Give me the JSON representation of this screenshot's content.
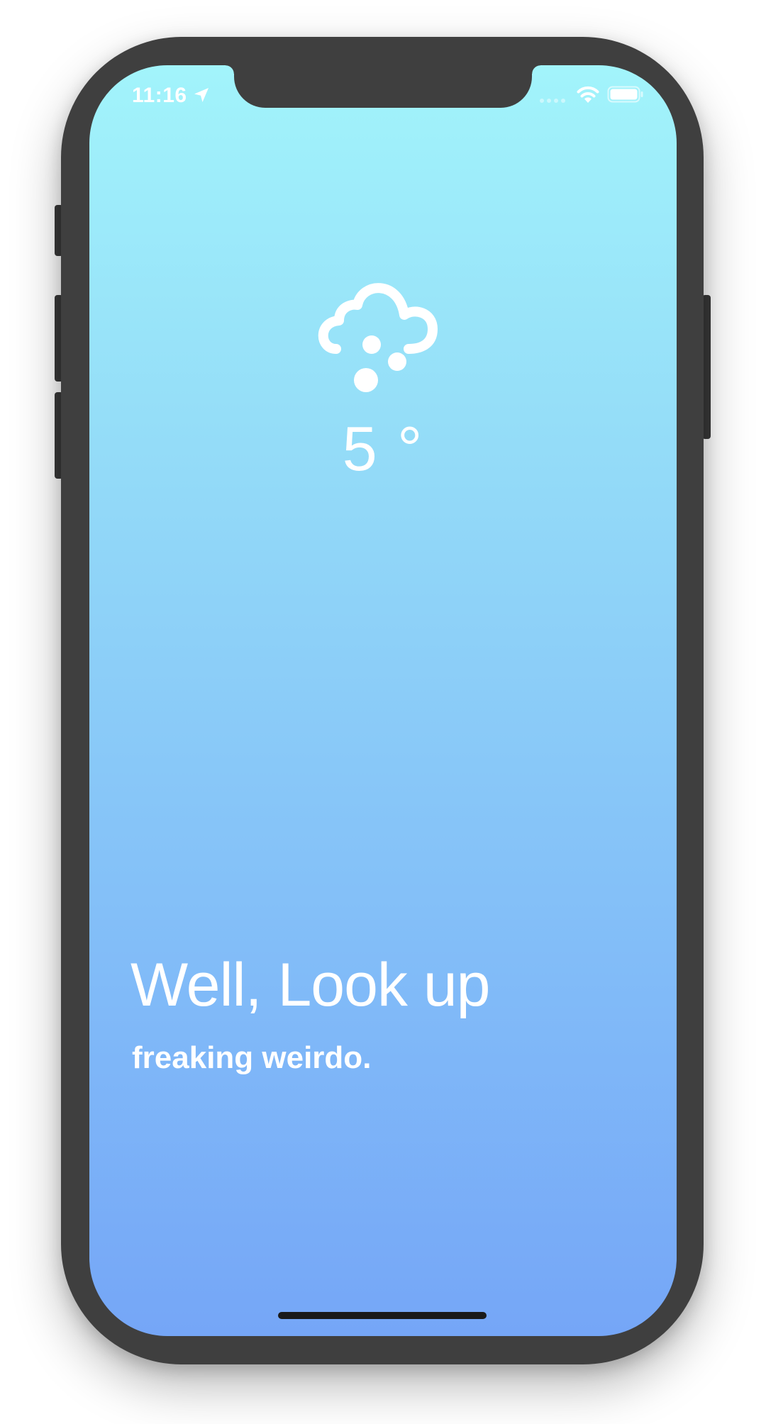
{
  "status_bar": {
    "time": "11:16",
    "location_icon": "location-arrow-icon",
    "wifi_icon": "wifi-icon",
    "battery_icon": "battery-icon"
  },
  "weather": {
    "condition_icon": "cloud-hail-icon",
    "temperature": "5 °"
  },
  "message": {
    "headline": "Well, Look up",
    "subline": "freaking weirdo."
  },
  "colors": {
    "gradient_top": "#a2f4fb",
    "gradient_bottom": "#75a6f7",
    "text": "#ffffff",
    "device_frame": "#3f3f3f"
  }
}
